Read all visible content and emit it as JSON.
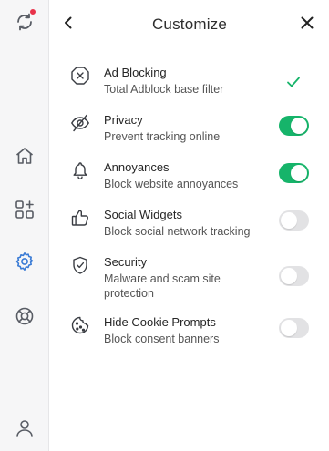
{
  "header": {
    "title": "Customize",
    "back_icon": "chevron-left-icon",
    "close_icon": "close-icon"
  },
  "sidebar": {
    "items": [
      {
        "icon": "sync-icon",
        "badge": "notification-dot"
      },
      {
        "icon": "home-icon"
      },
      {
        "icon": "apps-grid-plus-icon"
      },
      {
        "icon": "gear-icon",
        "active": true
      },
      {
        "icon": "lifebuoy-icon"
      },
      {
        "icon": "user-icon"
      }
    ]
  },
  "filters": [
    {
      "title": "Ad Blocking",
      "subtitle": "Total Adblock base filter",
      "icon": "ad-block-icon",
      "control": "check",
      "enabled": true
    },
    {
      "title": "Privacy",
      "subtitle": "Prevent tracking online",
      "icon": "eye-slash-icon",
      "control": "toggle",
      "enabled": true
    },
    {
      "title": "Annoyances",
      "subtitle": "Block website annoyances",
      "icon": "bell-icon",
      "control": "toggle",
      "enabled": true
    },
    {
      "title": "Social Widgets",
      "subtitle": "Block social network tracking",
      "icon": "thumbs-up-icon",
      "control": "toggle",
      "enabled": false
    },
    {
      "title": "Security",
      "subtitle": "Malware and scam site protection",
      "icon": "shield-check-icon",
      "control": "toggle",
      "enabled": false
    },
    {
      "title": "Hide Cookie Prompts",
      "subtitle": "Block consent banners",
      "icon": "cookie-icon",
      "control": "toggle",
      "enabled": false
    }
  ],
  "colors": {
    "accent": "#16b46a",
    "active_nav": "#3a7bd5",
    "toggle_off": "#e2e2e4",
    "badge": "#e8334a",
    "icon": "#585c64"
  }
}
